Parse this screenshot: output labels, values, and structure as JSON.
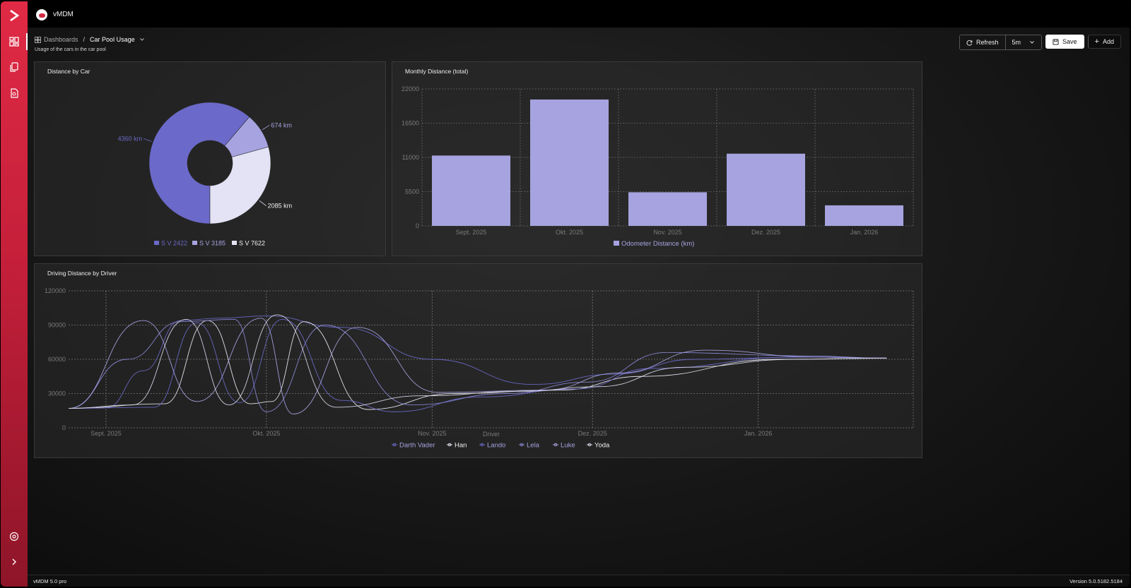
{
  "app": {
    "title": "vMDM"
  },
  "breadcrumb": {
    "root": "Dashboards",
    "separator": "/",
    "current": "Car Pool Usage"
  },
  "subtitle": "Usage of the cars in the car pool",
  "toolbar": {
    "refresh_label": "Refresh",
    "interval_value": "5m",
    "save_label": "Save",
    "add_label": "Add"
  },
  "panels": {
    "pie_title": "Distance by Car",
    "bar_title": "Monthly Distance (total)",
    "line_title": "Driving Distance by Driver"
  },
  "footer": {
    "edition": "vMDM 5.0 pro",
    "version": "Version 5.0.5182.5184"
  },
  "colors": {
    "accent_red": "#d62640",
    "series_dark": "#6b69c9",
    "series_mid": "#a6a3e0",
    "series_light": "#e4e3f5"
  },
  "chart_data": [
    {
      "type": "pie",
      "title": "Distance by Car",
      "categories": [
        "S V 2422",
        "S V 3185",
        "S V 7622"
      ],
      "values": [
        4360,
        674,
        2085
      ],
      "data_labels": [
        "4360 km",
        "674 km",
        "2085 km"
      ],
      "legend": "bottom"
    },
    {
      "type": "bar",
      "title": "Monthly Distance (total)",
      "categories": [
        "Sept. 2025",
        "Okt. 2025",
        "Nov. 2025",
        "Dez. 2025",
        "Jan. 2026"
      ],
      "series": [
        {
          "name": "Odometer Distance (km)",
          "values": [
            11300,
            20300,
            5400,
            11600,
            3300
          ]
        }
      ],
      "ylim": [
        0,
        22000
      ],
      "yticks": [
        0,
        5500,
        11000,
        16500,
        22000
      ],
      "grid": true,
      "legend": "bottom"
    },
    {
      "type": "line",
      "title": "Driving Distance by Driver",
      "xlabel": "Driver",
      "x_ticks": [
        "Sept. 2025",
        "Okt. 2025",
        "Nov. 2025",
        "Dez. 2025",
        "Jan. 2026"
      ],
      "ylim": [
        0,
        120000
      ],
      "yticks": [
        0,
        30000,
        60000,
        90000,
        120000
      ],
      "grid": true,
      "legend": "bottom",
      "series": [
        {
          "name": "Darth Vader",
          "x": [
            "2025-08-25",
            "2025-09-01",
            "2025-09-08",
            "2025-09-15",
            "2025-09-22",
            "2025-10-01",
            "2025-10-15",
            "2025-11-01",
            "2025-11-20",
            "2025-12-05",
            "2025-12-20",
            "2026-01-10",
            "2026-01-25"
          ],
          "values": [
            17000,
            17500,
            50000,
            94000,
            96000,
            98000,
            88000,
            60000,
            38000,
            47000,
            60000,
            62000,
            61000
          ]
        },
        {
          "name": "Han",
          "x": [
            "2025-08-25",
            "2025-09-12",
            "2025-09-20",
            "2025-09-28",
            "2025-10-02",
            "2025-10-08",
            "2025-10-20",
            "2025-11-05",
            "2025-11-25",
            "2025-12-10",
            "2026-01-05",
            "2026-01-25"
          ],
          "values": [
            17000,
            21000,
            94000,
            21000,
            23000,
            93000,
            16000,
            30000,
            33000,
            45000,
            60000,
            61000
          ]
        },
        {
          "name": "Lando",
          "x": [
            "2025-08-25",
            "2025-09-10",
            "2025-09-18",
            "2025-09-26",
            "2025-10-04",
            "2025-10-15",
            "2025-10-25",
            "2025-11-10",
            "2025-11-28",
            "2025-12-12",
            "2026-01-08",
            "2026-01-25"
          ],
          "values": [
            17000,
            18000,
            92000,
            22000,
            95000,
            24000,
            14000,
            27000,
            34000,
            52000,
            62000,
            61000
          ]
        },
        {
          "name": "Lela",
          "x": [
            "2025-08-25",
            "2025-09-05",
            "2025-09-15",
            "2025-09-25",
            "2025-10-01",
            "2025-10-12",
            "2025-10-28",
            "2025-11-15",
            "2025-11-30",
            "2025-12-15",
            "2026-01-10",
            "2026-01-25"
          ],
          "values": [
            17000,
            60000,
            93000,
            95000,
            14000,
            90000,
            20000,
            30000,
            40000,
            66000,
            63000,
            61000
          ]
        },
        {
          "name": "Luke",
          "x": [
            "2025-08-25",
            "2025-09-08",
            "2025-09-18",
            "2025-09-30",
            "2025-10-06",
            "2025-10-18",
            "2025-11-02",
            "2025-11-22",
            "2025-12-06",
            "2025-12-22",
            "2026-01-12",
            "2026-01-25"
          ],
          "values": [
            17000,
            94000,
            23000,
            96000,
            12000,
            88000,
            31000,
            33000,
            48000,
            68000,
            62000,
            61000
          ]
        },
        {
          "name": "Yoda",
          "x": [
            "2025-08-25",
            "2025-09-06",
            "2025-09-16",
            "2025-09-24",
            "2025-10-03",
            "2025-10-14",
            "2025-10-30",
            "2025-11-18",
            "2025-12-02",
            "2025-12-18",
            "2026-01-08",
            "2026-01-25"
          ],
          "values": [
            17000,
            20000,
            95000,
            20000,
            99000,
            18000,
            28000,
            32000,
            36000,
            53000,
            60000,
            61000
          ]
        }
      ]
    }
  ]
}
